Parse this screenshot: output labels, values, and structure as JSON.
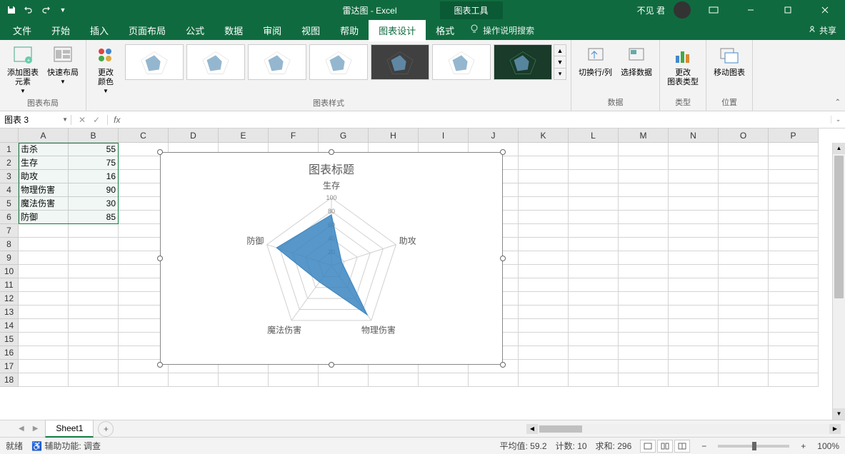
{
  "title_bar": {
    "doc_title": "雷达图 - Excel",
    "chart_tools": "图表工具",
    "user_name": "不见 君"
  },
  "ribbon_tabs": {
    "file": "文件",
    "home": "开始",
    "insert": "插入",
    "page_layout": "页面布局",
    "formulas": "公式",
    "data": "数据",
    "review": "审阅",
    "view": "视图",
    "help": "帮助",
    "chart_design": "图表设计",
    "format": "格式",
    "tell_me": "操作说明搜索",
    "share": "共享"
  },
  "ribbon": {
    "add_chart_element": "添加图表\n元素",
    "quick_layout": "快速布局",
    "change_colors": "更改\n颜色",
    "switch_row_col": "切换行/列",
    "select_data": "选择数据",
    "change_chart_type": "更改\n图表类型",
    "move_chart": "移动图表",
    "group_layout": "图表布局",
    "group_styles": "图表样式",
    "group_data": "数据",
    "group_type": "类型",
    "group_location": "位置"
  },
  "name_box": "图表 3",
  "columns": [
    "A",
    "B",
    "C",
    "D",
    "E",
    "F",
    "G",
    "H",
    "I",
    "J",
    "K",
    "L",
    "M",
    "N",
    "O",
    "P"
  ],
  "table": {
    "rows": [
      {
        "label": "击杀",
        "value": 55
      },
      {
        "label": "生存",
        "value": 75
      },
      {
        "label": "助攻",
        "value": 16
      },
      {
        "label": "物理伤害",
        "value": 90
      },
      {
        "label": "魔法伤害",
        "value": 30
      },
      {
        "label": "防御",
        "value": 85
      }
    ]
  },
  "chart_data": {
    "type": "radar",
    "title": "图表标题",
    "categories": [
      "生存",
      "助攻",
      "物理伤害",
      "魔法伤害",
      "防御"
    ],
    "values": [
      75,
      16,
      90,
      30,
      85
    ],
    "ticks": [
      20,
      40,
      60,
      80,
      100
    ],
    "max": 100,
    "fill": "#3b85c0"
  },
  "sheet_tab": "Sheet1",
  "status": {
    "ready": "就绪",
    "accessibility": "辅助功能: 调查",
    "avg_label": "平均值:",
    "avg": "59.2",
    "count_label": "计数:",
    "count": "10",
    "sum_label": "求和:",
    "sum": "296",
    "zoom": "100%"
  }
}
